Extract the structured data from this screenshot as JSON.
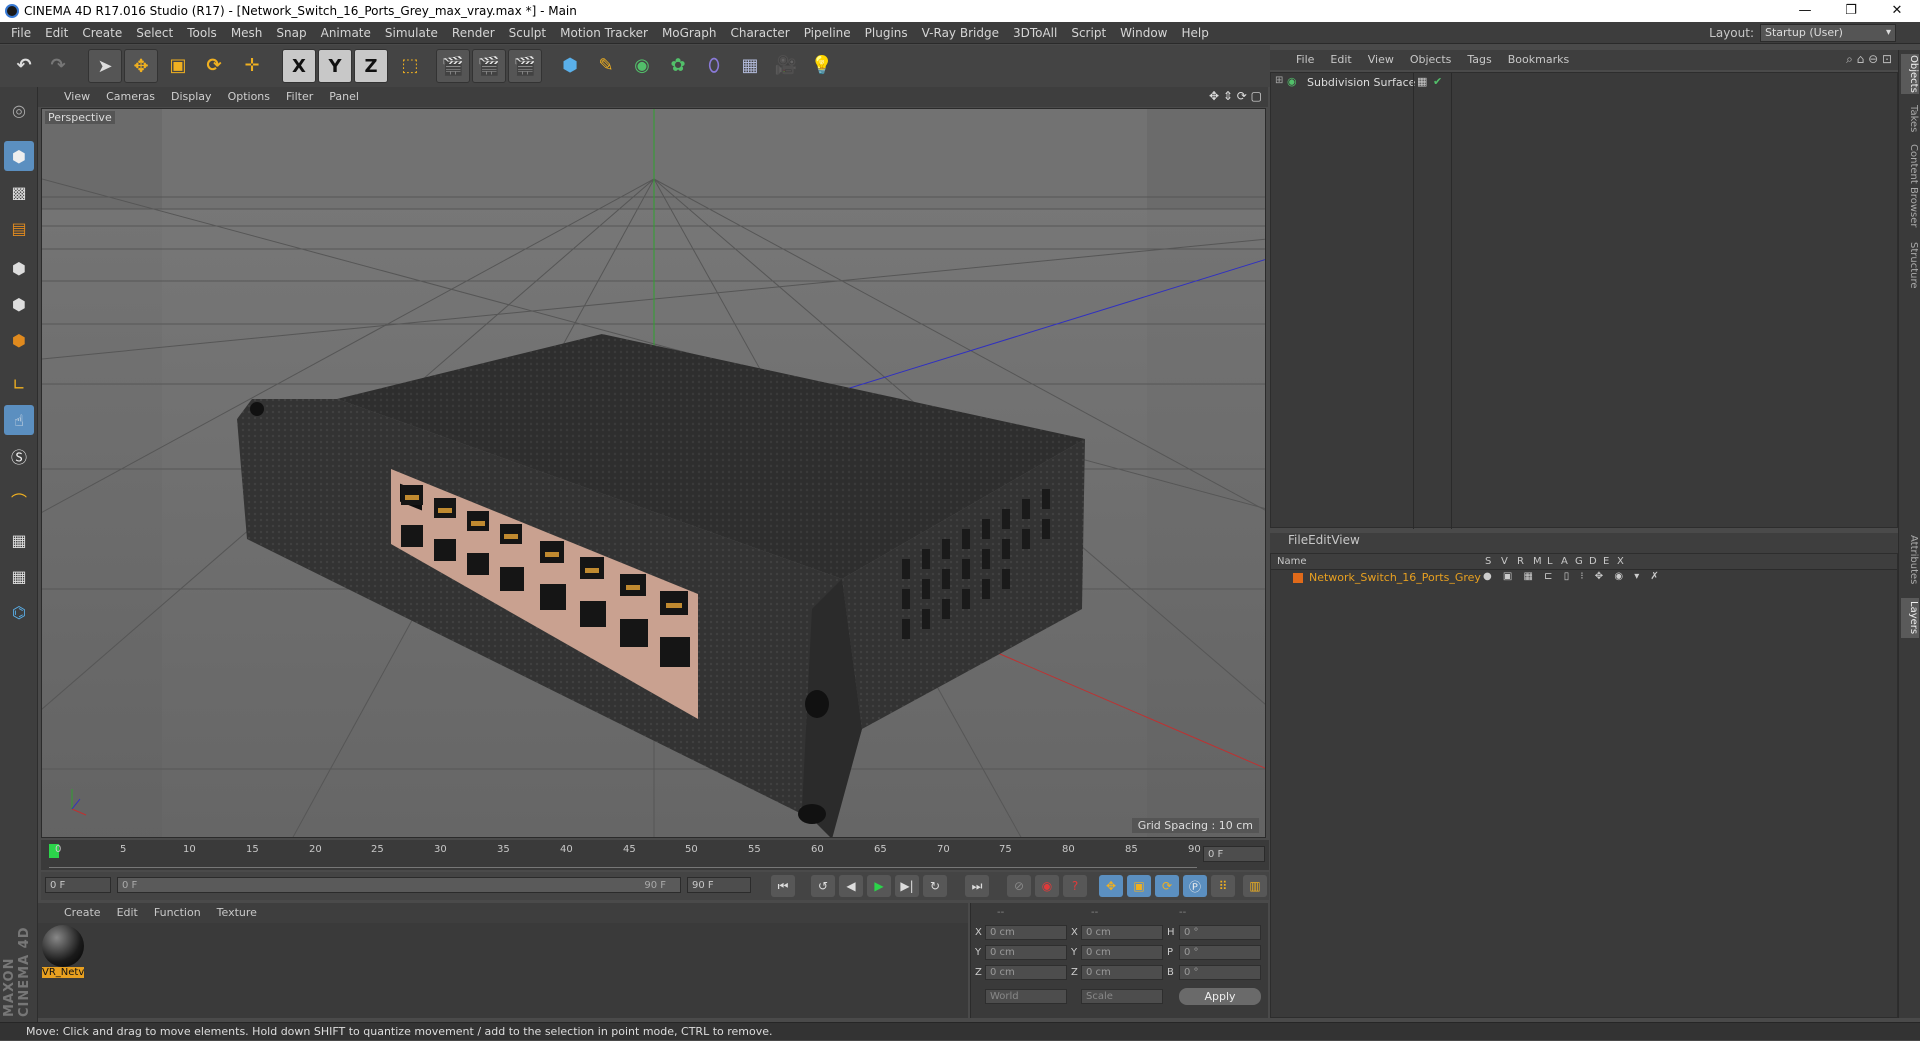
{
  "window": {
    "title": "CINEMA 4D R17.016 Studio (R17) - [Network_Switch_16_Ports_Grey_max_vray.max *] - Main",
    "minimize": "—",
    "restore": "❐",
    "close": "✕"
  },
  "menubar": {
    "items": [
      "File",
      "Edit",
      "Create",
      "Select",
      "Tools",
      "Mesh",
      "Snap",
      "Animate",
      "Simulate",
      "Render",
      "Sculpt",
      "Motion Tracker",
      "MoGraph",
      "Character",
      "Pipeline",
      "Plugins",
      "V-Ray Bridge",
      "3DToAll",
      "Script",
      "Window",
      "Help"
    ],
    "layout_label": "Layout:",
    "layout_value": "Startup (User)"
  },
  "toolbar": {
    "axis_x": "X",
    "axis_y": "Y",
    "axis_z": "Z"
  },
  "viewport": {
    "menu": [
      "View",
      "Cameras",
      "Display",
      "Options",
      "Filter",
      "Panel"
    ],
    "label": "Perspective",
    "grid_spacing": "Grid Spacing : 10 cm"
  },
  "timeline": {
    "ticks": [
      "0",
      "5",
      "10",
      "15",
      "20",
      "25",
      "30",
      "35",
      "40",
      "45",
      "50",
      "55",
      "60",
      "65",
      "70",
      "75",
      "80",
      "85",
      "90"
    ],
    "frame_end_field": "0 F",
    "start": "0 F",
    "range_start": "0 F",
    "range_end": "90 F",
    "end": "90 F"
  },
  "materials": {
    "menu": [
      "Create",
      "Edit",
      "Function",
      "Texture"
    ],
    "material_name": "VR_Netv"
  },
  "coordinates": {
    "header": [
      "--",
      "--",
      "--"
    ],
    "rows": [
      {
        "l1": "X",
        "v1": "0 cm",
        "l2": "X",
        "v2": "0 cm",
        "l3": "H",
        "v3": "0 °"
      },
      {
        "l1": "Y",
        "v1": "0 cm",
        "l2": "Y",
        "v2": "0 cm",
        "l3": "P",
        "v3": "0 °"
      },
      {
        "l1": "Z",
        "v1": "0 cm",
        "l2": "Z",
        "v2": "0 cm",
        "l3": "B",
        "v3": "0 °"
      }
    ],
    "mode": "World",
    "scale": "Scale",
    "apply": "Apply"
  },
  "objects": {
    "menu": [
      "File",
      "Edit",
      "View",
      "Objects",
      "Tags",
      "Bookmarks"
    ],
    "items": [
      "Subdivision Surface"
    ]
  },
  "layers": {
    "menu": [
      "File",
      "Edit",
      "View"
    ],
    "name_header": "Name",
    "cols": [
      "S",
      "V",
      "R",
      "M",
      "L",
      "A",
      "G",
      "D",
      "E",
      "X"
    ],
    "row_name": "Network_Switch_16_Ports_Grey",
    "row_color": "#e06a1a"
  },
  "side_tabs": [
    "Objects",
    "Takes",
    "Content Browser",
    "Structure",
    "Attributes",
    "Layers"
  ],
  "brand": "MAXON CINEMA 4D",
  "status": "Move: Click and drag to move elements. Hold down SHIFT to quantize movement / add to the selection in point mode, CTRL to remove."
}
